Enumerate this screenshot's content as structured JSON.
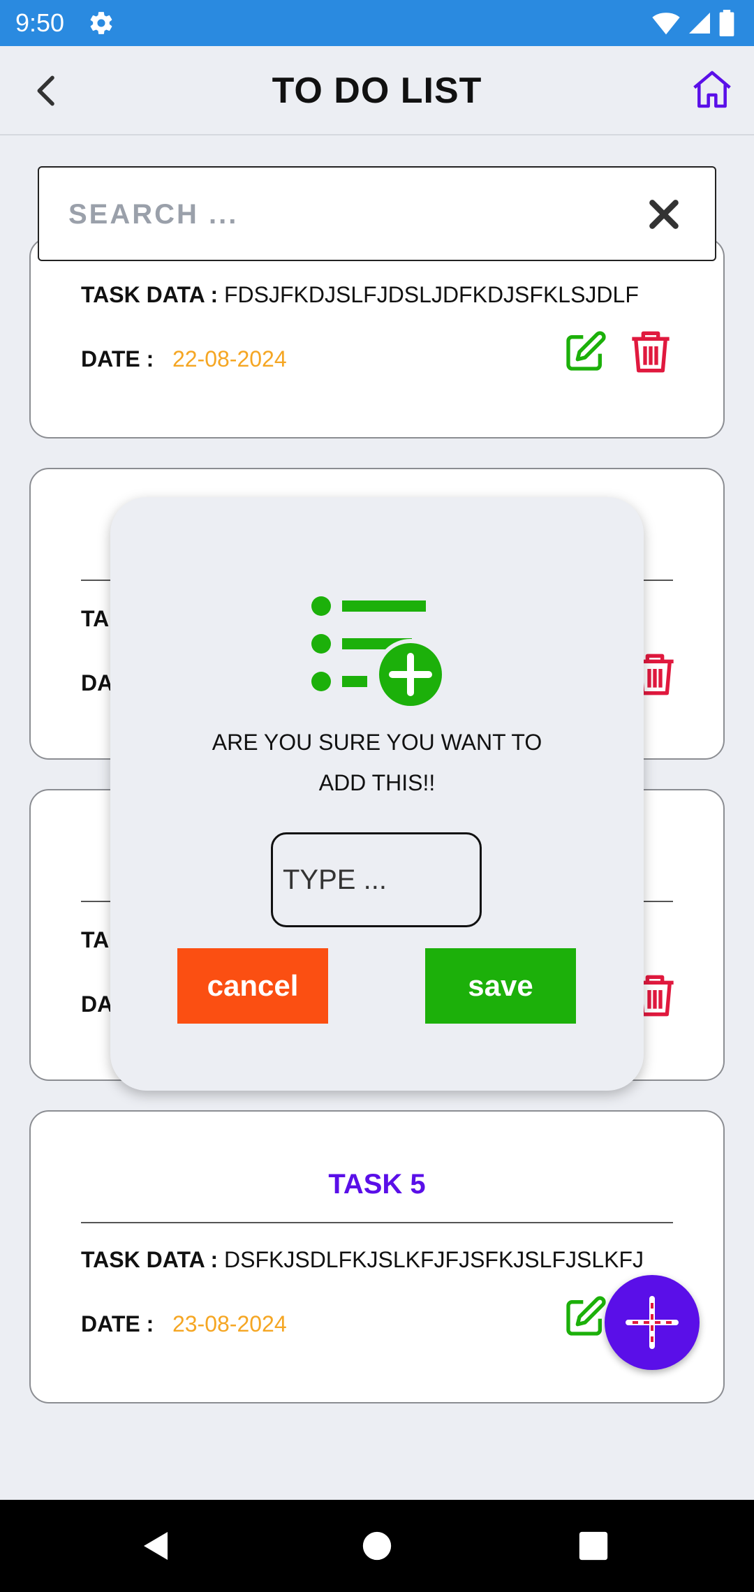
{
  "status_bar": {
    "time": "9:50"
  },
  "header": {
    "title": "TO DO LIST"
  },
  "search": {
    "placeholder": "SEARCH ..."
  },
  "tasks": [
    {
      "task_data_label": "TASK DATA :",
      "task_data": "FDSJFKDJSLFJDSLJDFKDJSFKLSJDLF",
      "date_label": "DATE :",
      "date": "22-08-2024"
    },
    {
      "task_data_label": "TA",
      "date_label": "DA"
    },
    {
      "task_data_label": "TA",
      "date_label": "DA"
    },
    {
      "title": "TASK 5",
      "task_data_label": "TASK DATA :",
      "task_data": "DSFKJSDLFKJSLKFJFJSFKJSLFJSLKFJ",
      "date_label": "DATE :",
      "date": "23-08-2024"
    }
  ],
  "dialog": {
    "message_line1": "ARE YOU SURE YOU WANT TO",
    "message_line2": "ADD THIS!!",
    "input_placeholder": "TYPE ...",
    "cancel_label": "cancel",
    "save_label": "save"
  },
  "colors": {
    "accent": "#5a0fe8",
    "status_bar": "#2a8ae0",
    "edit": "#1cb00a",
    "delete": "#e0193e",
    "date": "#f5a623",
    "cancel": "#fb4f12",
    "save": "#1cb00a"
  },
  "icons": [
    "back-arrow-icon",
    "home-icon",
    "close-icon",
    "edit-icon",
    "trash-icon",
    "add-list-icon",
    "plus-icon",
    "nav-back-icon",
    "nav-home-icon",
    "nav-recents-icon"
  ]
}
